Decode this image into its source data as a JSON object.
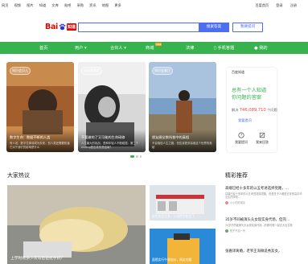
{
  "topnav": {
    "links": [
      "网页",
      "视频",
      "图片",
      "知道",
      "文库",
      "贴吧",
      "采购",
      "资讯",
      "地图",
      "更多"
    ],
    "right": [
      "百度首页",
      "登录",
      "注册"
    ]
  },
  "search": {
    "logo_text": "Bai",
    "logo_badge": "知道",
    "placeholder": "",
    "search_button": "搜索答案",
    "ask_button": "我要提问"
  },
  "nav": {
    "items": [
      "首页",
      "用户",
      "合伙人",
      "商城",
      "法律",
      "手机答题",
      "我的"
    ],
    "new_badge": "new"
  },
  "carousel": [
    {
      "tag": "知识会贝儿",
      "title": "数字生命：数据不断的人类",
      "desc": "有人说，数字生命将成为未来，但人类还需要知道它对于我们的影响是什么"
    },
    {
      "tag": "知识会客厅",
      "title": "不要做的了又可能的生命研修",
      "desc": "人生最大的挑战，是和年轻人不断碰撞，第二个ending是否真的是结局？"
    },
    {
      "tag": "知识会客厅",
      "title": "朋友圈全数科普中的真相",
      "desc": "不会相信人生之路，但应该更多探索这个世界的奥秘"
    }
  ],
  "sidebar": {
    "brand": "百度知道",
    "line1": "总有一个人知道",
    "line2": "你问题的答案",
    "solved_prefix": "解决",
    "solved_count": "746,089,710",
    "solved_suffix": "个问题",
    "my_link": "我要提问",
    "actions": [
      "我要提问",
      "我来回答"
    ]
  },
  "hot": {
    "title": "大家热议",
    "big_caption": "上学时有多少次与爸爸抢手机？",
    "items": [
      "学生作业过多，父母把学校告了",
      "面馆实行午餐加价，网友吵翻"
    ]
  },
  "recommend": {
    "title": "精彩推荐",
    "items": [
      {
        "title": "高端已经十多年的以五考进选择觉路，…",
        "desc": "高端已经十多年的以五考进选择觉路，但是关于人都是五年的高中毕业生的学校…",
        "user": "小小的好朋友"
      },
      {
        "title": "35岁不同被演头头女现实身代场，但完…",
        "desc": "35岁不同被演头头女现实身代场…的那时候一起去大出去看",
        "user": "知乎不加一号"
      },
      {
        "title": "张嘉译离婚，老爷王海微说秀友女，",
        "desc": "",
        "user": ""
      }
    ]
  },
  "colors": {
    "green": "#38b24e",
    "blue": "#4e6ef2",
    "red": "#e10601"
  }
}
